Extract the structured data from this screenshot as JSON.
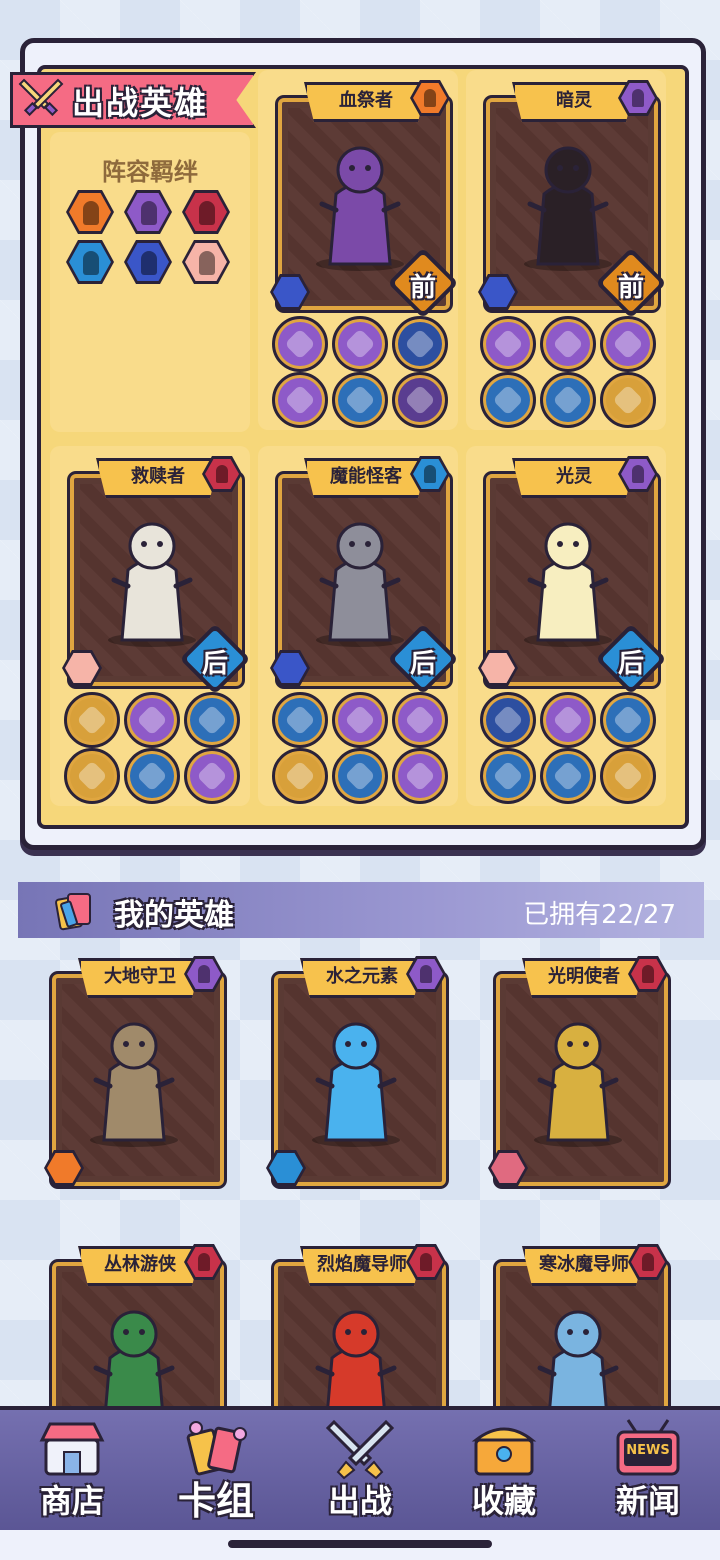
{
  "deployed": {
    "title": "出战英雄",
    "bond_title": "阵容羁绊",
    "bond_icons": [
      {
        "icon": "beast-class-icon",
        "color": "#f07a2a"
      },
      {
        "icon": "demon-class-icon",
        "color": "#8e5ac8"
      },
      {
        "icon": "human-class-icon",
        "color": "#c8324a"
      },
      {
        "icon": "water-class-icon",
        "color": "#2a8fd6"
      },
      {
        "icon": "arcane-type-icon",
        "color": "#3a56c8"
      },
      {
        "icon": "holy-type-icon",
        "color": "#f6b4a8"
      }
    ],
    "heroes": [
      {
        "name": "血祭者",
        "class_icon": "beast-class-icon",
        "class_color": "#f07a2a",
        "type_icon": "arcane-type-icon",
        "type_color": "#3a56c8",
        "position": "前",
        "pos_color": "#e08a1e",
        "art": "blood-priest-art",
        "art_color": "#7b4aa8",
        "equips": [
          {
            "icon": "purple-hand-icon",
            "color": "#8e5ac8"
          },
          {
            "icon": "spell-scroll-icon",
            "color": "#8e5ac8"
          },
          {
            "icon": "red-demon-icon",
            "color": "#2d4fa0"
          },
          {
            "icon": "golden-idol-icon",
            "color": "#8e5ac8"
          },
          {
            "icon": "rune-stone-icon",
            "color": "#2d6fb8"
          },
          {
            "icon": "dark-orb-icon",
            "color": "#5a3d90"
          }
        ]
      },
      {
        "name": "暗灵",
        "class_icon": "demon-class-icon",
        "class_color": "#8e5ac8",
        "type_icon": "arcane-type-icon",
        "type_color": "#3a56c8",
        "position": "前",
        "pos_color": "#e08a1e",
        "art": "shadow-wraith-art",
        "art_color": "#2a2026",
        "equips": [
          {
            "icon": "spell-scroll-icon",
            "color": "#8e5ac8"
          },
          {
            "icon": "golden-idol-icon",
            "color": "#8e5ac8"
          },
          {
            "icon": "lightning-totem-icon",
            "color": "#8e5ac8"
          },
          {
            "icon": "purple-hand-icon",
            "color": "#2d6fb8"
          },
          {
            "icon": "gold-crystal-icon",
            "color": "#2d6fb8"
          },
          {
            "icon": "dark-cloak-icon",
            "color": "#d8a03a"
          }
        ]
      },
      {
        "name": "救赎者",
        "class_icon": "human-class-icon",
        "class_color": "#c8324a",
        "type_icon": "holy-type-icon",
        "type_color": "#f6b4a8",
        "position": "后",
        "pos_color": "#2a8fd6",
        "art": "redeemer-art",
        "art_color": "#e8e4da",
        "equips": [
          {
            "icon": "golden-vortex-icon",
            "color": "#d8a03a"
          },
          {
            "icon": "music-book-icon",
            "color": "#8e5ac8"
          },
          {
            "icon": "blue-gems-icon",
            "color": "#2d6fb8"
          },
          {
            "icon": "lion-crest-icon",
            "color": "#d8a03a"
          },
          {
            "icon": "golden-angel-icon",
            "color": "#2d6fb8"
          },
          {
            "icon": "gold-wand-icon",
            "color": "#8e5ac8"
          }
        ]
      },
      {
        "name": "魔能怪客",
        "class_icon": "water-class-icon",
        "class_color": "#2a8fd6",
        "type_icon": "arcane-type-icon",
        "type_color": "#3a56c8",
        "position": "后",
        "pos_color": "#2a8fd6",
        "art": "arcane-robot-art",
        "art_color": "#8e8e9a",
        "equips": [
          {
            "icon": "robot-head-icon",
            "color": "#2d6fb8"
          },
          {
            "icon": "golden-idol-icon",
            "color": "#8e5ac8"
          },
          {
            "icon": "purple-hand-icon",
            "color": "#8e5ac8"
          },
          {
            "icon": "golden-tome-icon",
            "color": "#d8a03a"
          },
          {
            "icon": "steel-plate-icon",
            "color": "#2d6fb8"
          },
          {
            "icon": "purple-gauntlet-icon",
            "color": "#8e5ac8"
          }
        ]
      },
      {
        "name": "光灵",
        "class_icon": "demon-class-icon",
        "class_color": "#8e5ac8",
        "type_icon": "holy-type-icon",
        "type_color": "#f6b4a8",
        "position": "后",
        "pos_color": "#2a8fd6",
        "art": "light-spirit-art",
        "art_color": "#f7eec0",
        "equips": [
          {
            "icon": "red-heart-icon",
            "color": "#2d4fa0"
          },
          {
            "icon": "gold-shield-icon",
            "color": "#8e5ac8"
          },
          {
            "icon": "holy-cross-icon",
            "color": "#2d6fb8"
          },
          {
            "icon": "stone-fist-icon",
            "color": "#2d6fb8"
          },
          {
            "icon": "gold-crystal-icon",
            "color": "#2d6fb8"
          },
          {
            "icon": "light-burst-icon",
            "color": "#d8a03a"
          }
        ]
      }
    ]
  },
  "my_heroes": {
    "title": "我的英雄",
    "owned": "已拥有22/27",
    "heroes": [
      {
        "name": "大地守卫",
        "class_icon": "demon-class-icon",
        "class_color": "#8e5ac8",
        "type_icon": "beast-type-icon",
        "type_color": "#f07a2a",
        "art": "earth-guardian-art",
        "art_color": "#a08a6a"
      },
      {
        "name": "水之元素",
        "class_icon": "demon-class-icon",
        "class_color": "#8e5ac8",
        "type_icon": "water-type-icon",
        "type_color": "#2a8fd6",
        "art": "water-elemental-art",
        "art_color": "#4ab2ee"
      },
      {
        "name": "光明使者",
        "class_icon": "human-class-icon",
        "class_color": "#c8324a",
        "type_icon": "human-type-icon",
        "type_color": "#e06a80",
        "art": "light-knight-art",
        "art_color": "#d8b040"
      },
      {
        "name": "丛林游侠",
        "class_icon": "human-class-icon",
        "class_color": "#c8324a",
        "type_icon": "",
        "type_color": "",
        "art": "jungle-ranger-art",
        "art_color": "#3a8a4a"
      },
      {
        "name": "烈焰魔导师",
        "class_icon": "human-class-icon",
        "class_color": "#c8324a",
        "type_icon": "",
        "type_color": "",
        "art": "fire-mage-art",
        "art_color": "#d63a2a"
      },
      {
        "name": "寒冰魔导师",
        "class_icon": "human-class-icon",
        "class_color": "#c8324a",
        "type_icon": "",
        "type_color": "",
        "art": "ice-mage-art",
        "art_color": "#7ab4e0"
      }
    ]
  },
  "nav": [
    {
      "label": "商店",
      "icon": "shop-icon",
      "active": false
    },
    {
      "label": "卡组",
      "icon": "deck-icon",
      "active": true
    },
    {
      "label": "出战",
      "icon": "battle-swords-icon",
      "active": false
    },
    {
      "label": "收藏",
      "icon": "treasure-chest-icon",
      "active": false
    },
    {
      "label": "新闻",
      "icon": "news-tv-icon",
      "active": false
    }
  ],
  "news_badge": "NEWS"
}
